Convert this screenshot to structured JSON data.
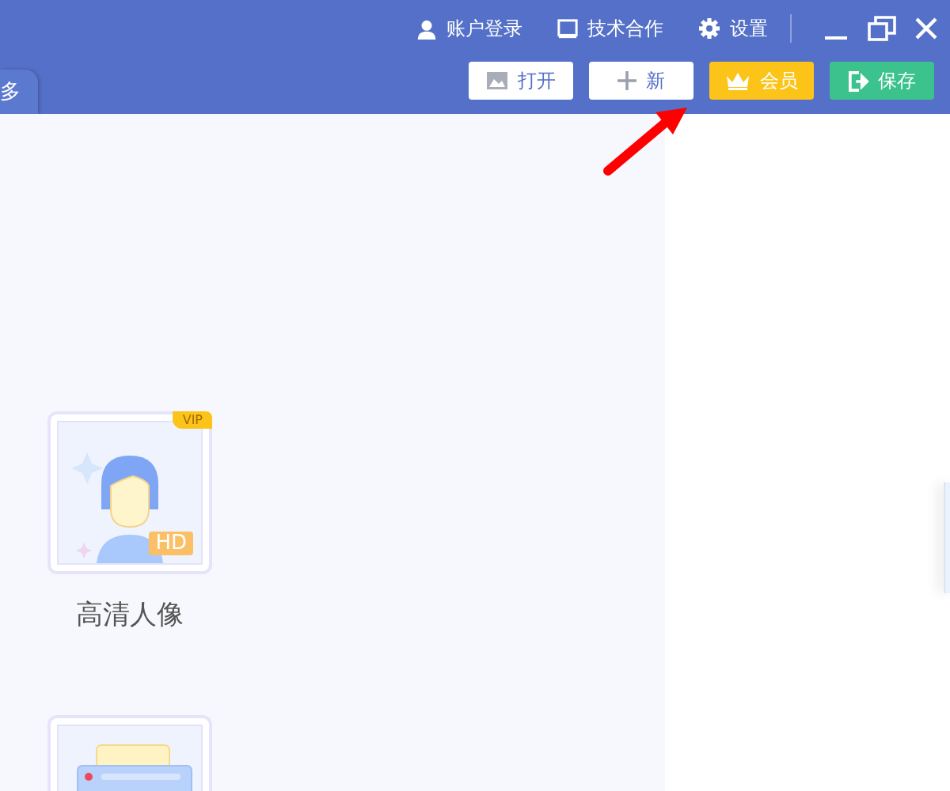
{
  "titlebar": {
    "items": [
      {
        "kind": "account",
        "label": "账户登录"
      },
      {
        "kind": "monitor",
        "label": "技术合作"
      },
      {
        "kind": "gear",
        "label": "设置"
      }
    ]
  },
  "tab": {
    "label": "多"
  },
  "toolbar": {
    "buttons": [
      {
        "kind": "image",
        "label": "打开"
      },
      {
        "kind": "plus",
        "label": "新"
      },
      {
        "kind": "crown",
        "label": "会员"
      },
      {
        "kind": "save",
        "label": "保存"
      }
    ]
  },
  "features": [
    {
      "kind": "portrait",
      "label": "高清人像",
      "badge": "VIP",
      "tag": "HD"
    },
    {
      "kind": "document"
    }
  ]
}
